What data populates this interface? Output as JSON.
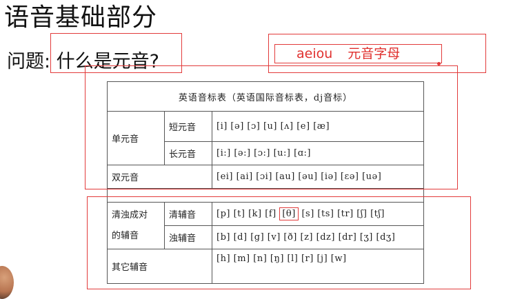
{
  "slide": {
    "title": "语音基础部分",
    "question": "问题: 什么是元音?",
    "vowel_letters": "aeiou",
    "vowel_letters_label": "元音字母"
  },
  "table": {
    "header": "英语音标表（英语国际音标表，dj音标）",
    "rows": {
      "monophthong": "单元音",
      "short_label": "短元音",
      "short_symbols": "[i] [ə] [ɔ] [u] [ʌ] [e] [æ]",
      "long_label": "长元音",
      "long_symbols": "[i:] [ə:] [ɔ:] [u:] [ɑ:]",
      "diphthong": "双元音",
      "diphthong_symbols": "[ei] [ai] [ɔi] [au] [əu] [iə] [ɛə] [uə]",
      "paired_consonants_line1": "清浊成对",
      "paired_consonants_line2": "的辅音",
      "voiceless_label": "清辅音",
      "voiceless_before": "[p]  [t]  [k] [f] ",
      "voiceless_highlight": "[θ]",
      "voiceless_after": " [s] [ts]  [tr]  [ʃ] [tʃ]",
      "voiced_label": "浊辅音",
      "voiced_symbols": "[b]  [d] [g]  [v] [ð] [z] [dz] [dr] [ʒ] [dʒ]",
      "other_consonants": "其它辅音",
      "other_symbols": "[h]  [m] [n] [ŋ] [l] [r] [j] [w]"
    }
  },
  "colors": {
    "annotation": "#e23a3a",
    "text": "#222222"
  }
}
